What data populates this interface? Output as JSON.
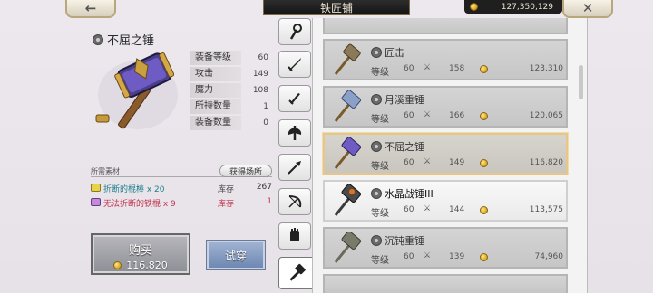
{
  "header": {
    "title": "铁匠铺",
    "gold": "127,350,129",
    "back_icon": "←",
    "close_icon": "✕"
  },
  "selected_item": {
    "name": "不屈之锤",
    "stats": [
      {
        "label": "装备等级",
        "value": "60"
      },
      {
        "label": "攻击",
        "value": "149"
      },
      {
        "label": "魔力",
        "value": "108"
      },
      {
        "label": "所持数量",
        "value": "1"
      },
      {
        "label": "装备数量",
        "value": "0"
      }
    ]
  },
  "materials": {
    "header": "所需素材",
    "obtain_label": "获得场所",
    "items": [
      {
        "name": "折断的棍棒 x 20",
        "stock_label": "库存",
        "stock": "267",
        "color": "#1f7f8a"
      },
      {
        "name": "无法折断的铁棍 x 9",
        "stock_label": "库存",
        "stock": "1",
        "color": "#c0304a"
      }
    ]
  },
  "actions": {
    "buy_label": "购买",
    "buy_price": "116,820",
    "try_label": "试穿"
  },
  "category_tabs": [
    "staff",
    "sword",
    "dagger",
    "axe",
    "spear",
    "bow",
    "gauntlet",
    "hammer"
  ],
  "list": {
    "level_label": "等级",
    "items": [
      {
        "name": "匠击",
        "level": "60",
        "attack": "158",
        "price": "123,310"
      },
      {
        "name": "月溪重锤",
        "level": "60",
        "attack": "166",
        "price": "120,065"
      },
      {
        "name": "不屈之锤",
        "level": "60",
        "attack": "149",
        "price": "116,820"
      },
      {
        "name": "水晶战锤III",
        "level": "60",
        "attack": "144",
        "price": "113,575"
      },
      {
        "name": "沉钝重锤",
        "level": "60",
        "attack": "139",
        "price": "74,960"
      }
    ]
  },
  "colors": {
    "accent_gold": "#d9a21a",
    "selected_border": "#e6c789",
    "try_button": "#7f96bf"
  }
}
